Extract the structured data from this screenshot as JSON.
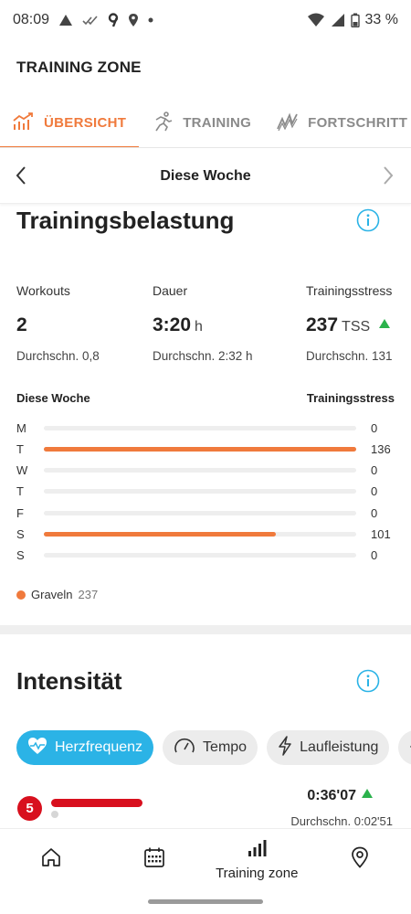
{
  "status_bar": {
    "time": "08:09",
    "battery": "33 %",
    "icons_left": [
      "navigation-arrow-icon",
      "double-check-icon",
      "app-9-icon",
      "location-pin-icon",
      "dot-icon"
    ],
    "icons_right": [
      "wifi-icon",
      "signal-icon",
      "battery-icon"
    ]
  },
  "app_bar": {
    "title": "TRAINING ZONE"
  },
  "tabs": [
    {
      "label": "ÜBERSICHT",
      "icon": "trend-chart-icon",
      "active": true
    },
    {
      "label": "TRAINING",
      "icon": "runner-icon",
      "active": false
    },
    {
      "label": "FORTSCHRITT",
      "icon": "progress-zigzag-icon",
      "active": false
    }
  ],
  "week_nav": {
    "title": "Diese Woche"
  },
  "training_load": {
    "title": "Trainingsbelastung",
    "stats": [
      {
        "label": "Workouts",
        "value": "2",
        "unit": "",
        "sub": "Durchschn. 0,8"
      },
      {
        "label": "Dauer",
        "value": "3:20",
        "unit": "h",
        "sub": "Durchschn. 2:32 h"
      },
      {
        "label": "Trainingsstress",
        "value": "237",
        "unit": "TSS",
        "sub": "Durchschn. 131",
        "trend": "up"
      }
    ],
    "week_header": {
      "left": "Diese Woche",
      "right": "Trainingsstress"
    },
    "days": [
      {
        "day": "M",
        "value": 0,
        "label": "0"
      },
      {
        "day": "T",
        "value": 136,
        "label": "136"
      },
      {
        "day": "W",
        "value": 0,
        "label": "0"
      },
      {
        "day": "T",
        "value": 0,
        "label": "0"
      },
      {
        "day": "F",
        "value": 0,
        "label": "0"
      },
      {
        "day": "S",
        "value": 101,
        "label": "101"
      },
      {
        "day": "S",
        "value": 0,
        "label": "0"
      }
    ],
    "max_value": 136,
    "legend": {
      "name": "Graveln",
      "value": "237",
      "color": "#f07a3c"
    }
  },
  "intensity": {
    "title": "Intensität",
    "chips": [
      {
        "label": "Herzfrequenz",
        "icon": "heart-icon",
        "active": true
      },
      {
        "label": "Tempo",
        "icon": "speedometer-icon",
        "active": false
      },
      {
        "label": "Laufleistung",
        "icon": "lightning-icon",
        "active": false
      }
    ],
    "zone": {
      "number": "5",
      "time": "0:36'07",
      "avg": "Durchschn. 0:02'51",
      "trend": "up"
    }
  },
  "bottom_nav": [
    {
      "name": "home",
      "icon": "home-icon",
      "label": ""
    },
    {
      "name": "calendar",
      "icon": "calendar-icon",
      "label": ""
    },
    {
      "name": "training-zone",
      "icon": "bar-chart-icon",
      "label": "Training zone"
    },
    {
      "name": "map",
      "icon": "map-pin-icon",
      "label": ""
    }
  ],
  "colors": {
    "accent": "#f07a3c",
    "info": "#2bb3e6",
    "zone5": "#d8101e",
    "trend_up": "#2bb24c"
  }
}
